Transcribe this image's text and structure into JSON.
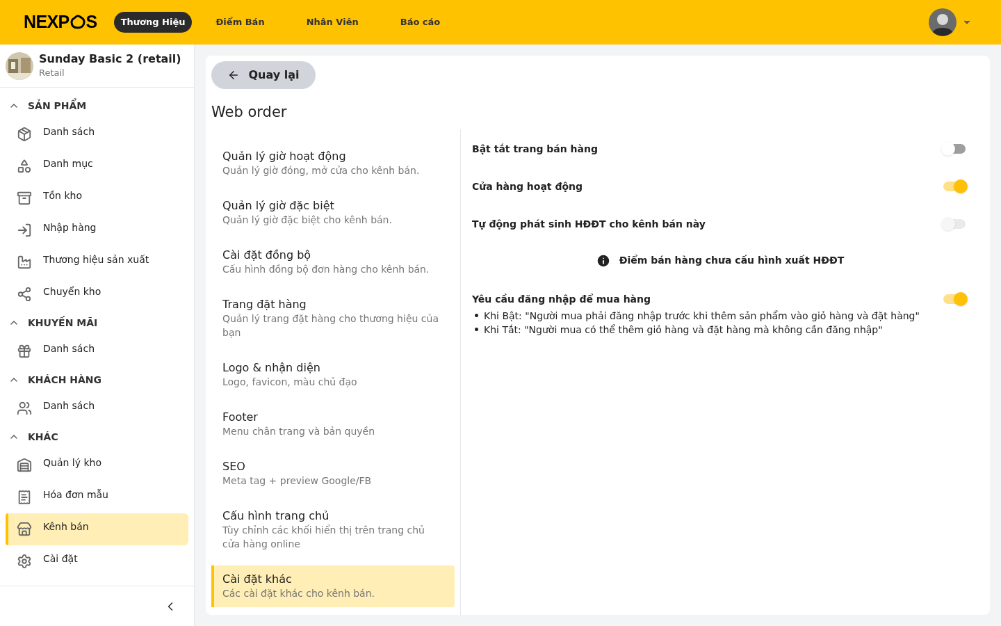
{
  "header": {
    "logo_left": "NEXP",
    "logo_right": "S",
    "nav": [
      {
        "label": "Thương Hiệu",
        "selected": true
      },
      {
        "label": "Điểm Bán",
        "selected": false
      },
      {
        "label": "Nhân Viên",
        "selected": false
      },
      {
        "label": "Báo cáo",
        "selected": false
      }
    ]
  },
  "store": {
    "name": "Sunday Basic 2 (retail)",
    "type": "Retail"
  },
  "sidebar": {
    "sections": [
      {
        "title": "SẢN PHẨM",
        "expanded": true,
        "items": [
          {
            "label": "Danh sách",
            "selected": false
          },
          {
            "label": "Danh mục",
            "selected": false
          },
          {
            "label": "Tồn kho",
            "selected": false
          },
          {
            "label": "Nhập hàng",
            "selected": false
          },
          {
            "label": "Thương hiệu sản xuất",
            "selected": false
          },
          {
            "label": "Chuyển kho",
            "selected": false
          }
        ]
      },
      {
        "title": "KHUYẾN MÃI",
        "expanded": true,
        "items": [
          {
            "label": "Danh sách",
            "selected": false
          }
        ]
      },
      {
        "title": "KHÁCH HÀNG",
        "expanded": true,
        "items": [
          {
            "label": "Danh sách",
            "selected": false
          }
        ]
      },
      {
        "title": "KHÁC",
        "expanded": true,
        "items": [
          {
            "label": "Quản lý kho",
            "selected": false
          },
          {
            "label": "Hóa đơn mẫu",
            "selected": false
          },
          {
            "label": "Kênh bán",
            "selected": true
          },
          {
            "label": "Cài đặt",
            "selected": false
          }
        ]
      }
    ]
  },
  "back_button": "Quay lại",
  "page_title": "Web order",
  "settings_menu": [
    {
      "title": "Quản lý giờ hoạt động",
      "description": "Quản lý giờ đóng, mở cửa cho kênh bán.",
      "selected": false
    },
    {
      "title": "Quản lý giờ đặc biệt",
      "description": "Quản lý giờ đặc biệt cho kênh bán.",
      "selected": false
    },
    {
      "title": "Cài đặt đồng bộ",
      "description": "Cấu hình đồng bộ đơn hàng cho kênh bán.",
      "selected": false
    },
    {
      "title": "Trang đặt hàng",
      "description": "Quản lý trang đặt hàng cho thương hiệu của bạn",
      "selected": false
    },
    {
      "title": "Logo & nhận diện",
      "description": "Logo, favicon, màu chủ đạo",
      "selected": false
    },
    {
      "title": "Footer",
      "description": "Menu chân trang và bản quyền",
      "selected": false
    },
    {
      "title": "SEO",
      "description": "Meta tag + preview Google/FB",
      "selected": false
    },
    {
      "title": "Cấu hình trang chủ",
      "description": "Tùy chỉnh các khối hiển thị trên trang chủ cửa hàng online",
      "selected": false
    },
    {
      "title": "Cài đặt khác",
      "description": "Các cài đặt khác cho kênh bán.",
      "selected": true
    }
  ],
  "settings": [
    {
      "kind": "toggle",
      "label": "Bật tắt trang bán hàng",
      "on": false,
      "disabled": false
    },
    {
      "kind": "toggle",
      "label": "Cửa hàng hoạt động",
      "on": true,
      "disabled": false
    },
    {
      "kind": "toggle",
      "label": "Tự động phát sinh HĐĐT cho kênh bán này",
      "on": false,
      "disabled": true
    },
    {
      "kind": "notice",
      "label": "Điểm bán hàng chưa cấu hình xuất HĐĐT"
    },
    {
      "kind": "toggle",
      "label": "Yêu cầu đăng nhập để mua hàng",
      "on": true,
      "disabled": false,
      "notes": [
        "Khi Bật: \"Người mua phải đăng nhập trước khi thêm sản phẩm vào giỏ hàng và đặt hàng\"",
        "Khi Tắt: \"Người mua có thể thêm giỏ hàng và đặt hàng mà không cần đăng nhập\""
      ]
    }
  ]
}
